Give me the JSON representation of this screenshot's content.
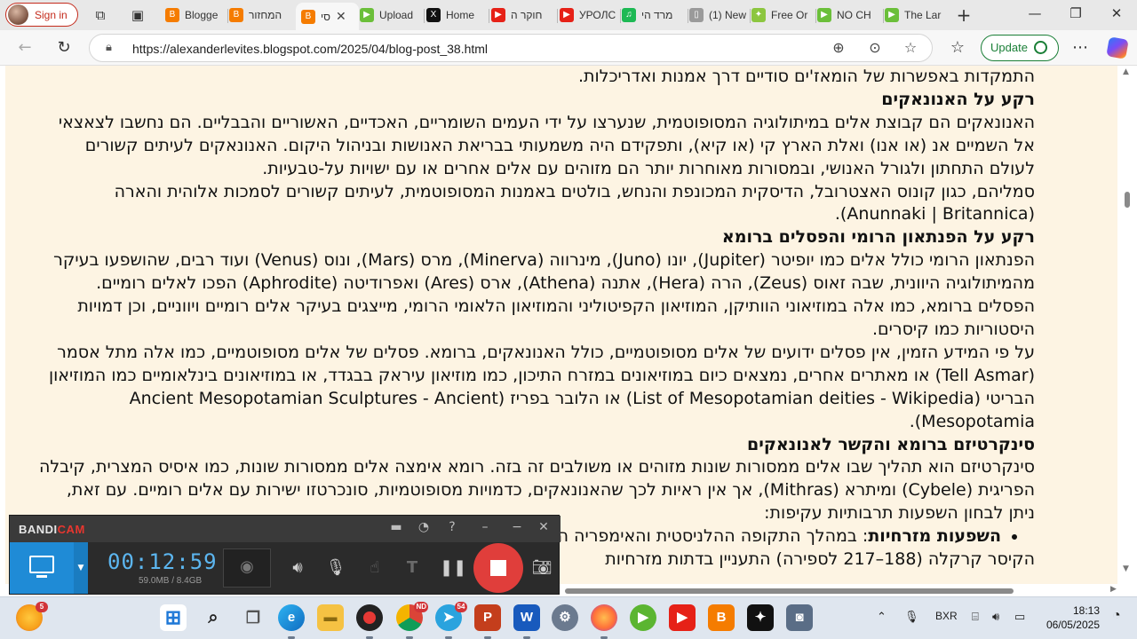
{
  "browser": {
    "profile_label": "Sign in",
    "tabs": [
      {
        "label": "Blogge",
        "fav": "B",
        "color": "#f57c00"
      },
      {
        "label": "המחזור",
        "fav": "B",
        "color": "#f57c00"
      },
      {
        "label": "סי",
        "fav": "B",
        "color": "#f57c00"
      },
      {
        "label": "Upload",
        "fav": "▶",
        "color": "#6bbf3a"
      },
      {
        "label": "Home",
        "fav": "X",
        "color": "#111111"
      },
      {
        "label": "חוקר ה",
        "fav": "▶",
        "color": "#e62117"
      },
      {
        "label": "УРОЛС",
        "fav": "▶",
        "color": "#e62117"
      },
      {
        "label": "מרד הי",
        "fav": "♫",
        "color": "#1db954"
      },
      {
        "label": "(1) New",
        "fav": "▯",
        "color": "#9a9a9a"
      },
      {
        "label": "Free Or",
        "fav": "✦",
        "color": "#8cc63f"
      },
      {
        "label": "NO CH",
        "fav": "▶",
        "color": "#6bbf3a"
      },
      {
        "label": "The Lar",
        "fav": "▶",
        "color": "#6bbf3a"
      }
    ],
    "url": "https://alexanderlevites.blogspot.com/2025/04/blog-post_38.html",
    "update_label": "Update"
  },
  "article": {
    "p0": "התמקדות באפשרות של הומאז'ים סודיים דרך אמנות ואדריכלות.",
    "h1": "רקע על האנונאקים",
    "p1": "האנונאקים הם קבוצת אלים במיתולוגיה המסופוטמית, שנערצו על ידי העמים השומריים, האכדיים, האשוריים והבבליים. הם נחשבו לצאצאי אל השמיים אנ (או אנו) ואלת הארץ קי (או קיא), ותפקידם היה משמעותי בבריאת האנושות ובניהול היקום. האנונאקים לעיתים קשורים לעולם התחתון ולגורל האנושי, ובמסורות מאוחרות יותר הם מזוהים עם אלים אחרים או עם ישויות על-טבעיות.",
    "p2": "סמליהם, כגון קונוס האצטרובל, הדיסקית המכונפת והנחש, בולטים באמנות המסופוטמית, לעיתים קשורים לסמכות אלוהית והארה (Anunnaki | Britannica).",
    "h2": "רקע על הפנתאון הרומי והפסלים ברומא",
    "p3": "הפנתאון הרומי כולל אלים כמו יופיטר (Jupiter), יונו (Juno), מינרווה (Minerva), מרס (Mars), ונוס (Venus) ועוד רבים, שהושפעו בעיקר מהמיתולוגיה היוונית, שבה זאוס (Zeus), הרה (Hera), אתנה (Athena), ארס (Ares) ואפרודיטה (Aphrodite) הפכו לאלים רומיים. הפסלים ברומא, כמו אלה במוזיאוני הוותיקן, המוזיאון הקפיטוליני והמוזיאון הלאומי הרומי, מייצגים בעיקר אלים רומיים ויווניים, וכן דמויות היסטוריות כמו קיסרים.",
    "p4": "על פי המידע הזמין, אין פסלים ידועים של אלים מסופוטמיים, כולל האנונאקים, ברומא. פסלים של אלים מסופוטמיים, כמו אלה מתל אסמר (Tell Asmar) או מאתרים אחרים, נמצאים כיום במוזיאונים במזרח התיכון, כמו מוזיאון עיראק בבגדד, או במוזיאונים בינלאומיים כמו המוזיאון הבריטי (List of Mesopotamian deities - Wikipedia) או הלובר בפריז (Ancient Mesopotamian Sculptures - Ancient Mesopotamia).",
    "h3": "סינקרטיזם ברומא והקשר לאנונאקים",
    "p5": "סינקרטיזם הוא תהליך שבו אלים ממסורות שונות מזוהים או משולבים זה בזה. רומא אימצה אלים ממסורות שונות, כמו איסיס המצרית, קיבלה הפריגית (Cybele) ומיתרא (Mithras), אך אין ראיות לכך שהאנונאקים, כדמויות מסופוטמיות, סונכרטזו ישירות עם אלים רומיים. עם זאת, ניתן לבחון השפעות תרבותיות עקיפות:",
    "li_bold": "השפעות מזרחיות",
    "li_text": ": במהלך התקופה ההלניסטית והאימפריה הרומית, היו קשרים תרבותיים בין רומא למזרח. לדוגמה,",
    "p6": "הקיסר קרקלה (188–217 לספירה) התעניין בדתות מזרחיות"
  },
  "bandicam": {
    "logo_a": "BANDI",
    "logo_b": "CAM",
    "timer": "00:12:59",
    "size": "59.0MB / 8.4GB"
  },
  "taskbar": {
    "language": "BXR",
    "time": "18:13",
    "date": "06/05/2025",
    "badge_browser": "5",
    "badge_chrome": "ND",
    "badge_telegram": "54"
  }
}
